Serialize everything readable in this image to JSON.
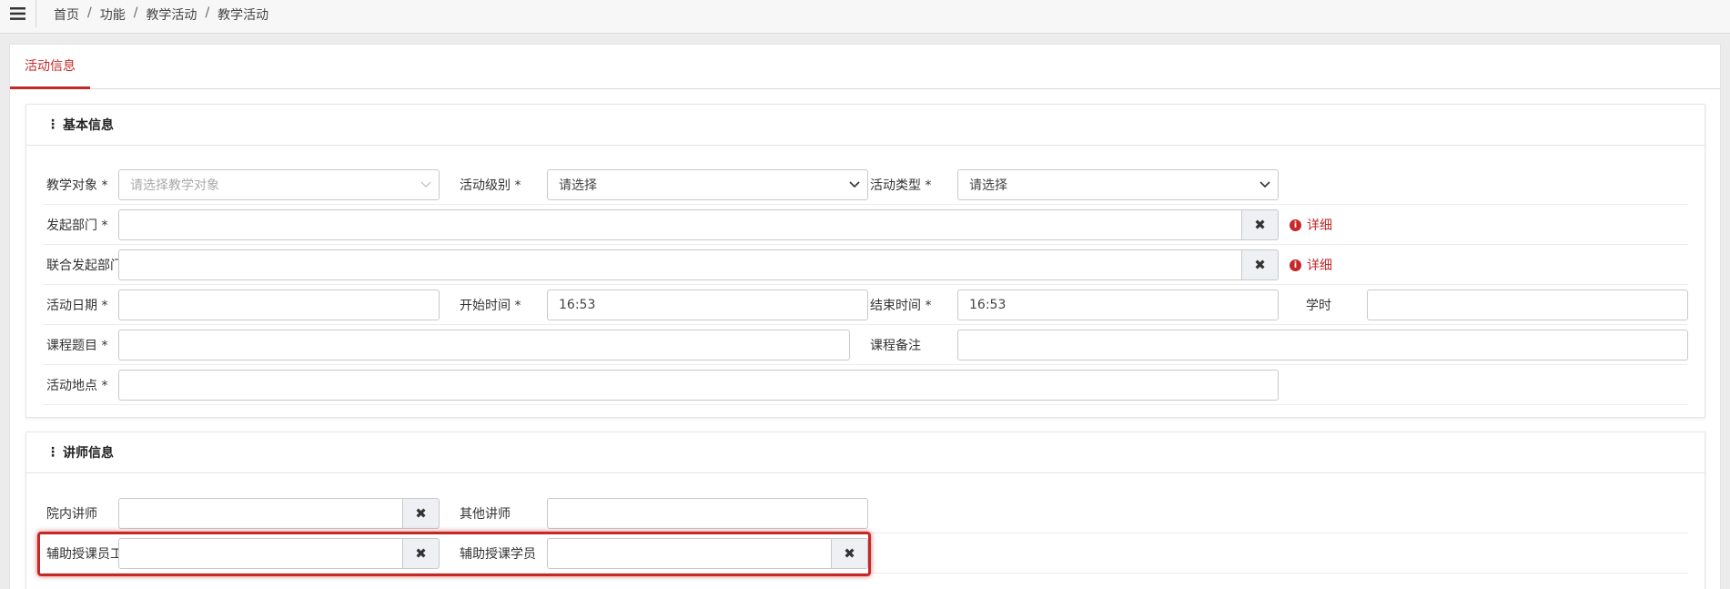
{
  "breadcrumb": [
    "首页",
    "功能",
    "教学活动",
    "教学活动"
  ],
  "tab": "活动信息",
  "basic": {
    "title": "基本信息",
    "target_label": "教学对象 *",
    "target_placeholder": "请选择教学对象",
    "level_label": "活动级别 *",
    "level_value": "请选择",
    "type_label": "活动类型 *",
    "type_value": "请选择",
    "dept_label": "发起部门 *",
    "joint_dept_label": "联合发起部门",
    "detail_label": "详细",
    "date_label": "活动日期 *",
    "start_label": "开始时间 *",
    "start_value": "16:53",
    "end_label": "结束时间 *",
    "end_value": "16:53",
    "hours_label": "学时",
    "topic_label": "课程题目 *",
    "remark_label": "课程备注",
    "place_label": "活动地点 *"
  },
  "lecturer": {
    "title": "讲师信息",
    "internal_label": "院内讲师",
    "other_label": "其他讲师",
    "assist_staff_label": "辅助授课员工",
    "assist_student_label": "辅助授课学员"
  },
  "clear_glyph": "✖",
  "colors": {
    "accent": "#c62828"
  }
}
